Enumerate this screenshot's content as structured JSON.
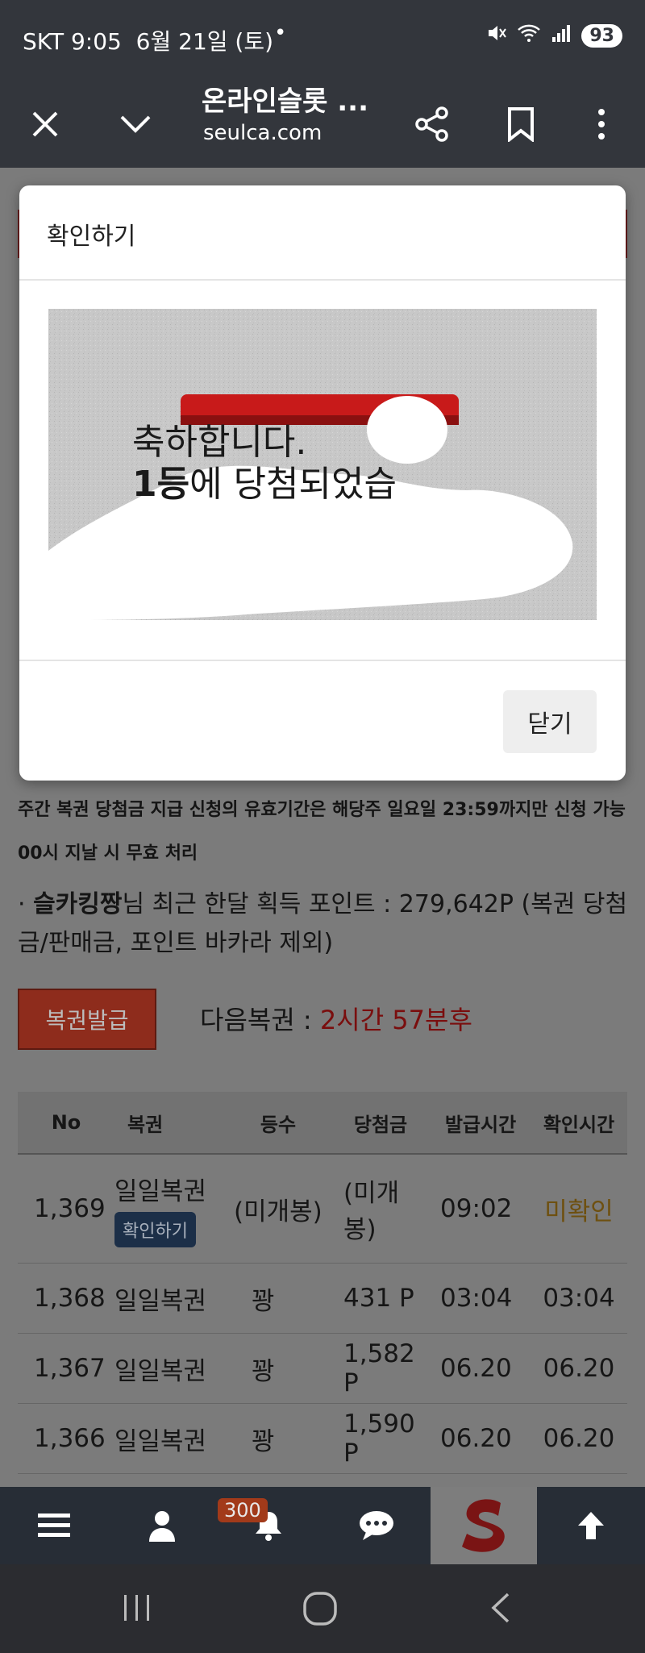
{
  "status_bar": {
    "carrier_time": "SKT 9:05",
    "date": "6월 21일 (토)",
    "dot": "•",
    "battery": "93"
  },
  "toolbar": {
    "title": "온라인슬롯 ...",
    "url": "seulca.com"
  },
  "modal": {
    "title": "확인하기",
    "image_line1": "축하합니다.",
    "image_line2_bold": "1등",
    "image_line2_rest": "에 당첨되었습",
    "close_label": "닫기"
  },
  "page": {
    "notice": "주간 복권 당첨금 지급 신청의 유효기간은 해당주 일요일 23:59까지만 신청 가능 00시 지날 시 무효 처리",
    "points_prefix": "· ",
    "points_user": "슬카킹짱",
    "points_text": "님 최근 한달 획득 포인트 : 279,642P (복권 당첨금/판매금, 포인트 바카라 제외)",
    "issue_button": "복권발급",
    "next_label": "다음복권 : ",
    "next_value": "2시간 57분후"
  },
  "table": {
    "headers": [
      "No",
      "복권",
      "등수",
      "당첨금",
      "발급시간",
      "확인시간"
    ],
    "rows": [
      {
        "no": "1,369",
        "ticket": "일일복권",
        "action": "확인하기",
        "rank": "(미개봉)",
        "prize": "(미개봉)",
        "issued": "09:02",
        "checked": "미확인"
      },
      {
        "no": "1,368",
        "ticket": "일일복권",
        "rank": "꽝",
        "prize": "431 P",
        "issued": "03:04",
        "checked": "03:04"
      },
      {
        "no": "1,367",
        "ticket": "일일복권",
        "rank": "꽝",
        "prize": "1,582 P",
        "issued": "06.20",
        "checked": "06.20"
      },
      {
        "no": "1,366",
        "ticket": "일일복권",
        "rank": "꽝",
        "prize": "1,590 P",
        "issued": "06.20",
        "checked": "06.20"
      }
    ]
  },
  "bottom_nav": {
    "notification_badge": "300",
    "icons": [
      "menu-icon",
      "user-icon",
      "bell-icon",
      "chat-icon",
      "site-logo",
      "arrow-up-icon"
    ]
  },
  "colors": {
    "header_bg": "#33363c",
    "accent_red": "#c0392b",
    "unconfirmed": "#d49a1f"
  }
}
